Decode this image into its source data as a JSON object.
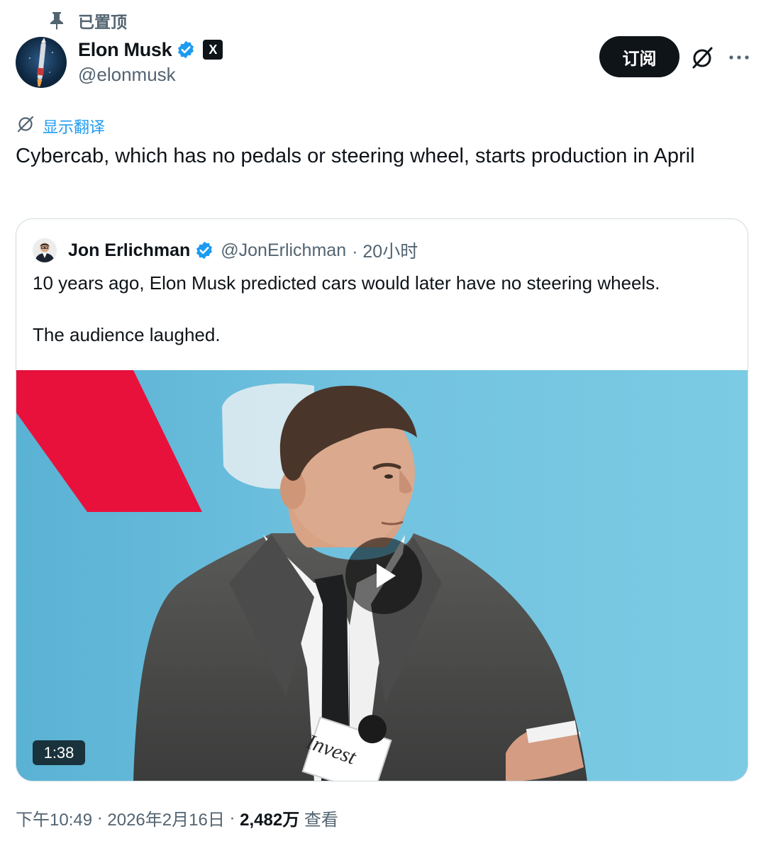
{
  "pinned": {
    "label": "已置顶",
    "icon": "pin-icon"
  },
  "author": {
    "name": "Elon Musk",
    "handle": "@elonmusk",
    "verified": true,
    "affiliate_badge": "X"
  },
  "actions": {
    "subscribe_label": "订阅",
    "grok_icon": "grok-icon",
    "more_icon": "more-icon"
  },
  "translate_label": "显示翻译",
  "tweet_text": "Cybercab, which has no pedals or steering wheel, starts production in April",
  "quote": {
    "name": "Jon Erlichman",
    "handle": "@JonErlichman",
    "time": "· 20小时",
    "verified": true,
    "text_lines": [
      "10 years ago, Elon Musk predicted cars would later have no steering wheels.",
      "The audience laughed."
    ],
    "video": {
      "duration": "1:38",
      "microphone_text": "Invest"
    }
  },
  "footer": {
    "time": "下午10:49",
    "sep1": " · ",
    "date": "2026年2月16日",
    "sep2": " · ",
    "views_count": "2,482万",
    "views_label": " 查看"
  },
  "colors": {
    "text": "#0f1419",
    "secondary": "#536471",
    "accent": "#1d9bf0",
    "border": "#cfd9de",
    "video_bg": "#6cc0de",
    "red_stripe": "#e8113c"
  }
}
